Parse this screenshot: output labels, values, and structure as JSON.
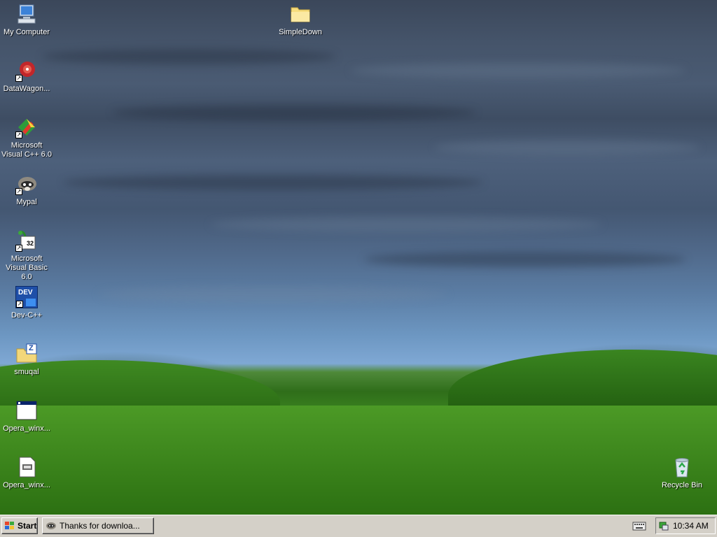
{
  "desktop": {
    "icons": [
      {
        "label": "My Computer",
        "icon": "my-computer-icon"
      },
      {
        "label": "DataWagon...",
        "icon": "datawagon-icon"
      },
      {
        "label": "Microsoft Visual C++ 6.0",
        "icon": "visual-cpp-icon"
      },
      {
        "label": "Mypal",
        "icon": "mypal-icon"
      },
      {
        "label": "Microsoft Visual Basic 6.0",
        "icon": "visual-basic-icon"
      },
      {
        "label": "Dev-C++",
        "icon": "dev-cpp-icon"
      },
      {
        "label": "smuqal",
        "icon": "zip-folder-icon"
      },
      {
        "label": "Opera_winx...",
        "icon": "application-window-icon"
      },
      {
        "label": "Opera_winx...",
        "icon": "msi-installer-icon"
      },
      {
        "label": "SimpleDown",
        "icon": "folder-icon"
      },
      {
        "label": "Recycle Bin",
        "icon": "recycle-bin-icon"
      }
    ],
    "dev_badge": "DEV",
    "zip_badge": "Z",
    "vb_badge": "32"
  },
  "taskbar": {
    "start_label": "Start",
    "task_label": "Thanks for downloa...",
    "clock": "10:34 AM"
  }
}
